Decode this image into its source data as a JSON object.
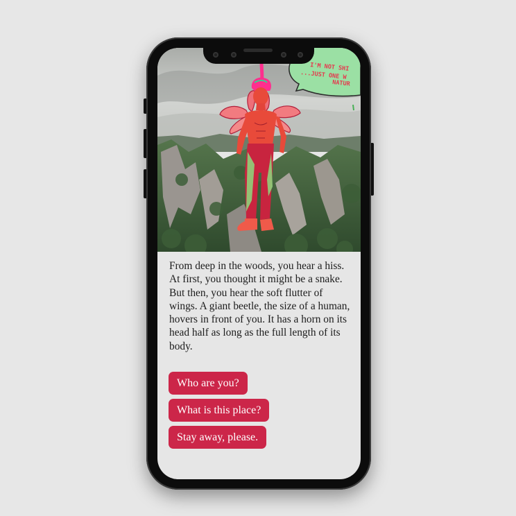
{
  "scene": {
    "speech_line1": "I'M NOT SHI",
    "speech_line2": "...JUST ONE W",
    "speech_line3": "NATUR",
    "colors": {
      "sky": "#c9ccc9",
      "forest": "#4d6e46",
      "figure": "#e84a3a",
      "pants": "#c8243f",
      "hair": "#ff2f8e",
      "bubble": "#9be0a4"
    }
  },
  "story": {
    "text": "From deep in the woods, you hear a hiss. At first, you thought it might be a snake. But then, you hear the soft flutter of wings. A giant beetle, the size of a human, hovers in front of you. It has a horn on its head half as long as the full length of its body."
  },
  "choices": [
    {
      "label": "Who are you?"
    },
    {
      "label": "What is this place?"
    },
    {
      "label": "Stay away, please."
    }
  ],
  "colors": {
    "accent": "#cc2649",
    "screen_bg": "#e6e6e6",
    "page_bg": "#e7e7e7",
    "phone_frame": "#0c0c0c"
  }
}
